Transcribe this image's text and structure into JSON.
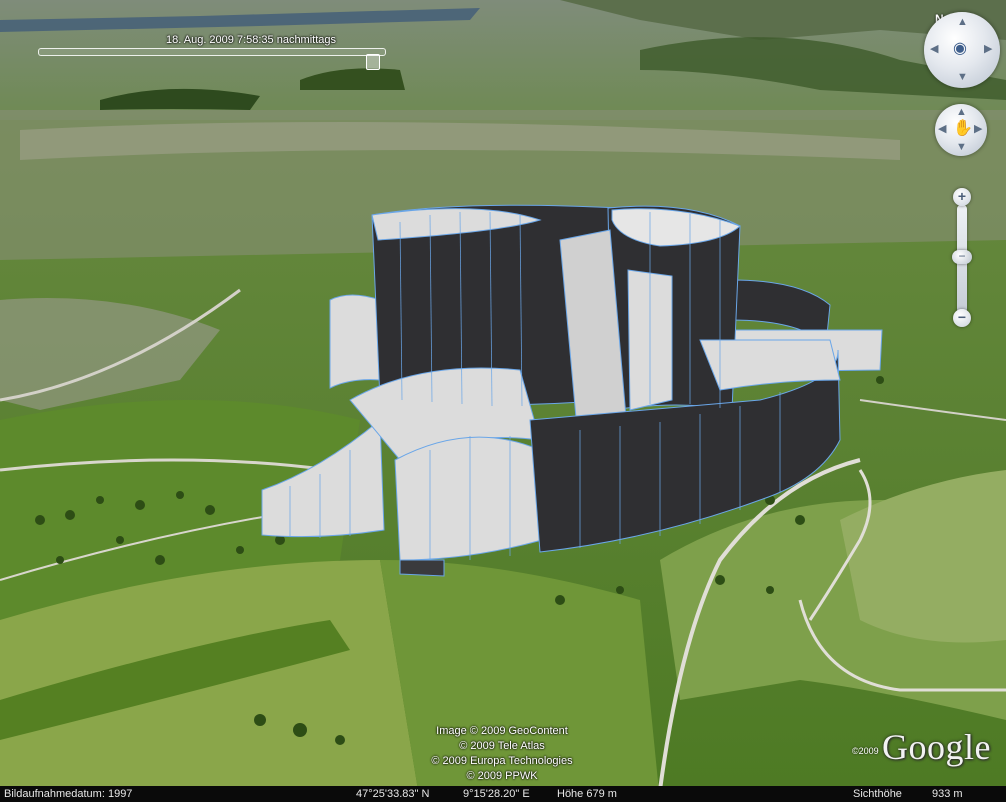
{
  "timeline": {
    "label": "18. Aug. 2009   7:58:35 nachmittags"
  },
  "navigation": {
    "north_label": "N",
    "look_icon": "eye-icon",
    "move_icon": "hand-icon",
    "zoom_in_label": "+",
    "zoom_out_label": "−",
    "zoom_slider_label": "−"
  },
  "copyright": {
    "lines": [
      "Image © 2009 GeoContent",
      "© 2009 Tele Atlas",
      "© 2009 Europa Technologies",
      "© 2009 PPWK"
    ]
  },
  "logo": {
    "year": "©2009",
    "word": "Google"
  },
  "status": {
    "imagery_date": "Bildaufnahmedatum: 1997",
    "latitude": "47°25'33.83\" N",
    "longitude": "9°15'28.20\" E",
    "elevation": "Höhe 679 m",
    "eye_alt_label": "Sichthöhe",
    "eye_alt_value": "933 m"
  },
  "colors": {
    "wall_dark": "#2f2f32",
    "wall_light": "#dcdcdc",
    "wall_edge": "#6aa6e8",
    "statusbar": "#0a0a0a"
  }
}
